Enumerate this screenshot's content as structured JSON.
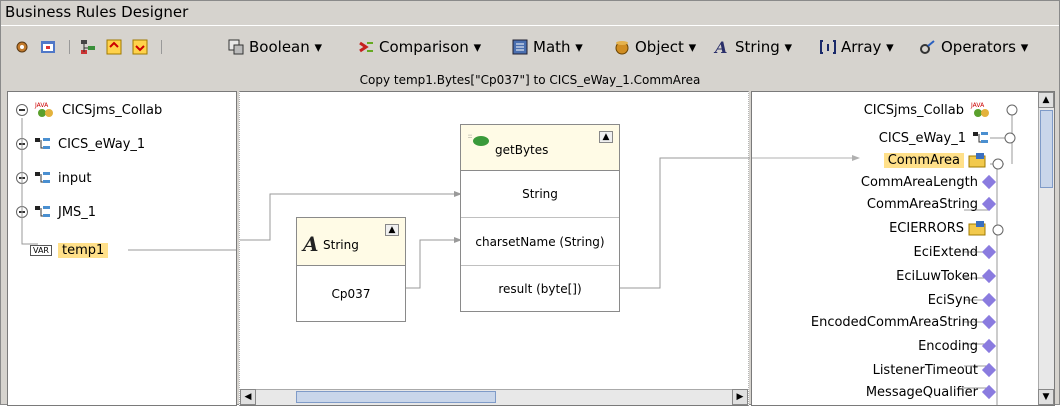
{
  "window": {
    "title": "Business Rules Designer"
  },
  "toolbar": {
    "boolean": "Boolean ▾",
    "comparison": "Comparison ▾",
    "math": "Math ▾",
    "object": "Object ▾",
    "string": "String ▾",
    "array": "Array ▾",
    "operators": "Operators ▾"
  },
  "status": "Copy temp1.Bytes[\"Cp037\"] to CICS_eWay_1.CommArea",
  "left_tree": {
    "items": [
      "CICSjms_Collab",
      "CICS_eWay_1",
      "input",
      "JMS_1",
      "temp1"
    ],
    "var_tag": "VAR"
  },
  "canvas": {
    "string_box": {
      "title": "String",
      "value": "Cp037"
    },
    "getbytes_box": {
      "title": "getBytes",
      "param1": "String",
      "param2": "charsetName (String)",
      "result": "result (byte[])"
    }
  },
  "right_tree": {
    "root": "CICSjms_Collab",
    "eway": "CICS_eWay_1",
    "items": [
      "CommArea",
      "CommAreaLength",
      "CommAreaString",
      "ECIERRORS",
      "EciExtend",
      "EciLuwToken",
      "EciSync",
      "EncodedCommAreaString",
      "Encoding",
      "ListenerTimeout",
      "MessageQualifier"
    ]
  },
  "colors": {
    "highlight": "#ffe08a",
    "diamond": "#8a7bdf",
    "scroll_thumb": "#c9d6ea"
  }
}
